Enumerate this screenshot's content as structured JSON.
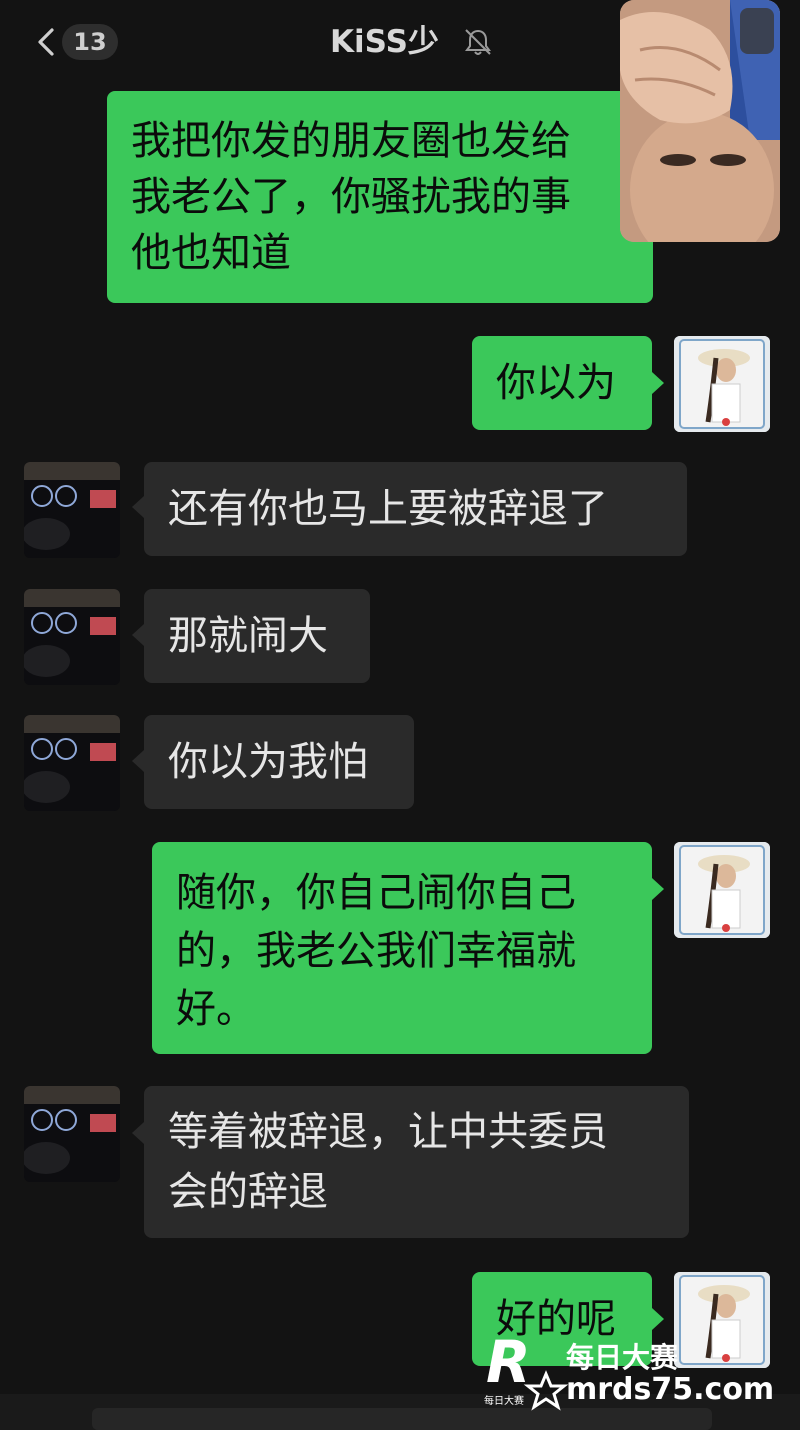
{
  "header": {
    "back_count": "13",
    "title": "KiSS少"
  },
  "messages": [
    {
      "side": "out",
      "lines": [
        "我把你发的朋友圈也发给",
        "我老公了，你骚扰我的事",
        "他也知道"
      ]
    },
    {
      "side": "out",
      "lines": [
        "你以为"
      ]
    },
    {
      "side": "in",
      "lines": [
        "还有你也马上要被辞退了"
      ]
    },
    {
      "side": "in",
      "lines": [
        "那就闹大"
      ]
    },
    {
      "side": "in",
      "lines": [
        "你以为我怕"
      ]
    },
    {
      "side": "out",
      "lines": [
        "随你，你自己闹你自己",
        "的，我老公我们幸福就",
        "好。"
      ]
    },
    {
      "side": "in",
      "lines": [
        "等着被辞退，让中共委员",
        "会的辞退"
      ]
    },
    {
      "side": "out",
      "lines": [
        "好的呢"
      ]
    }
  ],
  "watermark": {
    "logo_letter": "R",
    "logo_caption": "每日大赛",
    "name": "每日大赛",
    "site": "mrds75.com"
  },
  "colors": {
    "background": "#131313",
    "outgoing_bubble": "#3bc85a",
    "incoming_bubble": "#2a2a2a"
  }
}
